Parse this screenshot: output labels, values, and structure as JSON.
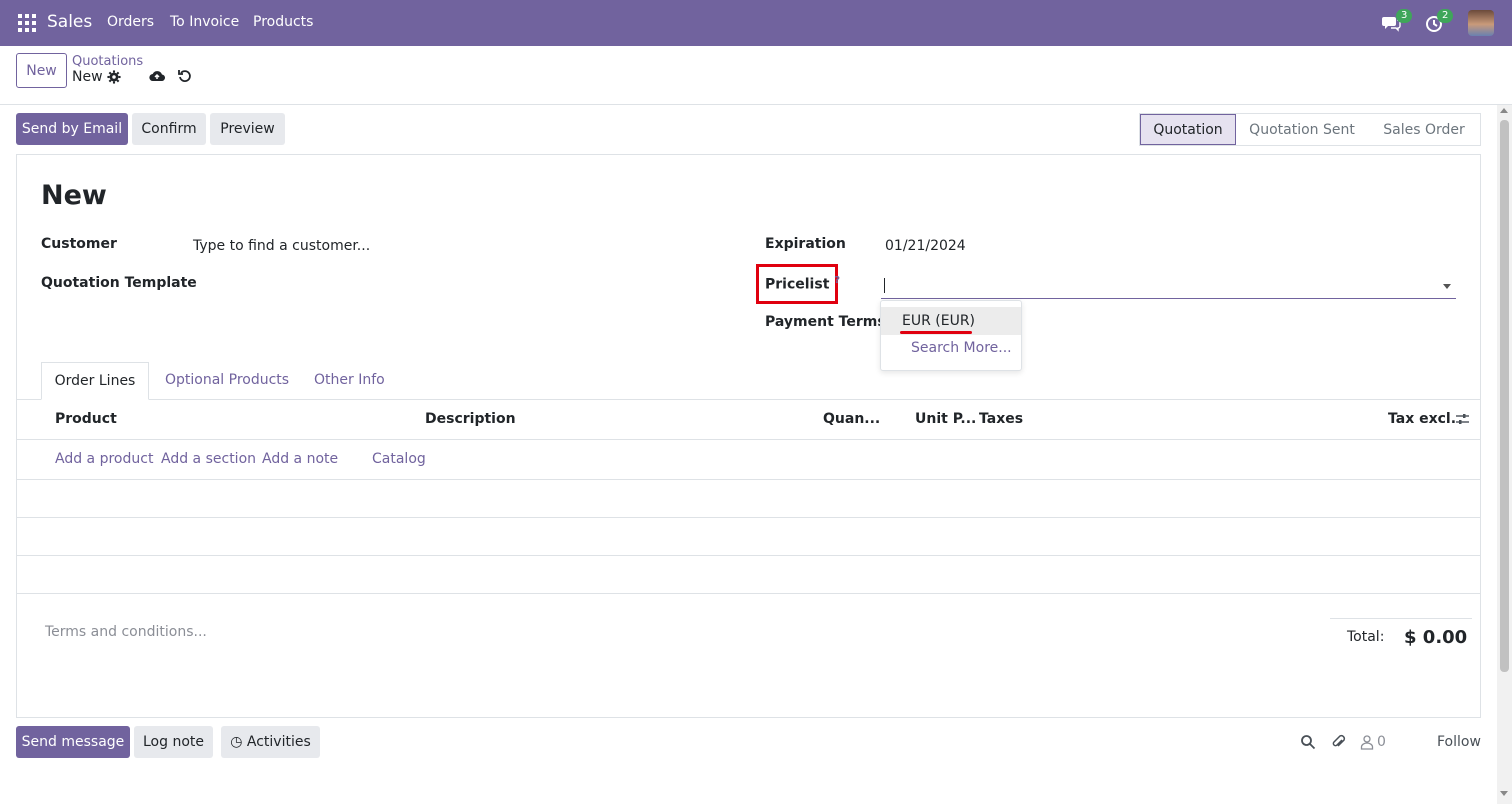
{
  "navbar": {
    "brand": "Sales",
    "menu": [
      "Orders",
      "To Invoice",
      "Products"
    ],
    "messages_count": "3",
    "activities_count": "2"
  },
  "control_panel": {
    "new_label": "New",
    "breadcrumb_parent": "Quotations",
    "breadcrumb_current": "New"
  },
  "actions": {
    "send_email": "Send by Email",
    "confirm": "Confirm",
    "preview": "Preview"
  },
  "statusbar": {
    "stages": [
      "Quotation",
      "Quotation Sent",
      "Sales Order"
    ],
    "active": "Quotation"
  },
  "form": {
    "title": "New",
    "customer_label": "Customer",
    "customer_placeholder": "Type to find a customer...",
    "template_label": "Quotation Template",
    "expiration_label": "Expiration",
    "expiration_value": "01/21/2024",
    "pricelist_label": "Pricelist",
    "pricelist_help": "?",
    "pricelist_value": "",
    "payment_terms_label": "Payment Terms"
  },
  "pricelist_dropdown": {
    "options": [
      "EUR (EUR)"
    ],
    "search_more": "Search More..."
  },
  "tabs": [
    "Order Lines",
    "Optional Products",
    "Other Info"
  ],
  "table": {
    "headers": [
      "Product",
      "Description",
      "Quan...",
      "Unit P...",
      "Taxes",
      "Tax excl."
    ],
    "add_product": "Add a product",
    "add_section": "Add a section",
    "add_note": "Add a note",
    "catalog": "Catalog"
  },
  "footer": {
    "terms_placeholder": "Terms and conditions...",
    "total_label": "Total:",
    "total_value": "$ 0.00"
  },
  "chatter": {
    "send_message": "Send message",
    "log_note": "Log note",
    "activities": "Activities",
    "followers_count": "0",
    "follow": "Follow"
  },
  "colors": {
    "brand": "#71639e",
    "highlight_red": "#e0000f",
    "badge_green": "#3fa65a"
  }
}
